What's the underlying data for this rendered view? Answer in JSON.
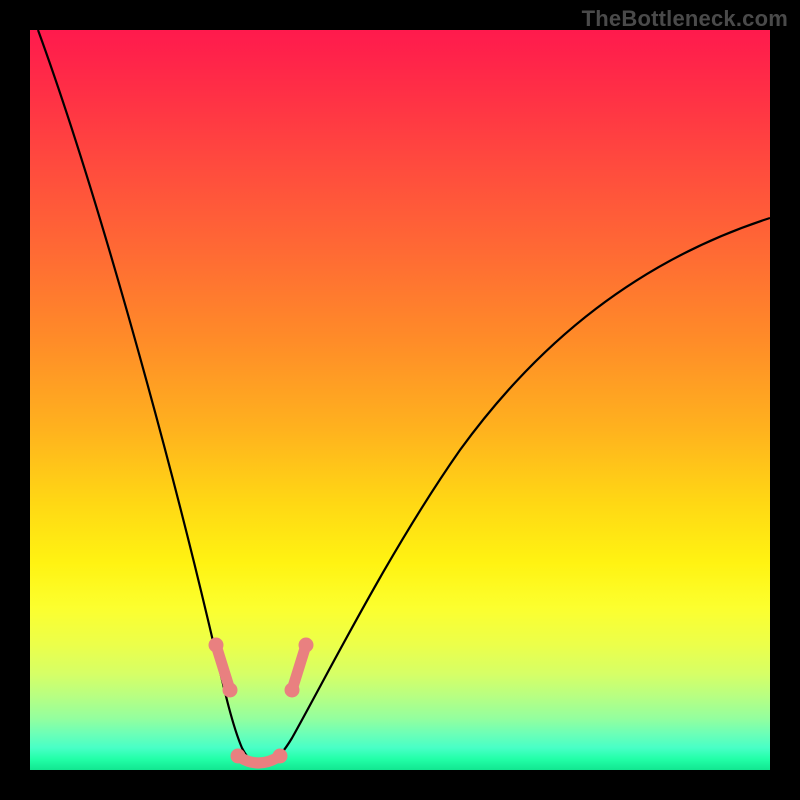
{
  "watermark": "TheBottleneck.com",
  "chart_data": {
    "type": "line",
    "title": "",
    "xlabel": "",
    "ylabel": "",
    "xlim": [
      0,
      100
    ],
    "ylim": [
      0,
      100
    ],
    "grid": false,
    "legend": false,
    "series": [
      {
        "name": "bottleneck-curve",
        "x": [
          0,
          5,
          10,
          15,
          20,
          22,
          24,
          26,
          28,
          29,
          30,
          31,
          32,
          34,
          36,
          40,
          45,
          50,
          55,
          60,
          65,
          70,
          75,
          80,
          85,
          90,
          95,
          100
        ],
        "y": [
          100,
          85,
          70,
          55,
          40,
          30,
          22,
          14,
          7,
          3,
          1,
          1,
          3,
          8,
          14,
          24,
          34,
          42,
          49,
          55,
          60,
          64,
          68,
          71,
          73,
          74,
          75,
          75
        ]
      }
    ],
    "highlight_segments": [
      {
        "name": "descent-end",
        "x": [
          24.5,
          26.0
        ],
        "y": [
          18,
          12
        ]
      },
      {
        "name": "trough",
        "x": [
          27.5,
          32.0
        ],
        "y": [
          2,
          2
        ]
      },
      {
        "name": "ascent-start",
        "x": [
          32.5,
          34.5
        ],
        "y": [
          10,
          16
        ]
      }
    ],
    "background_gradient": {
      "top": "#ff1a4d",
      "bottom": "#12e690",
      "stops_note": "smooth red→orange→yellow→lime→green vertical"
    }
  }
}
